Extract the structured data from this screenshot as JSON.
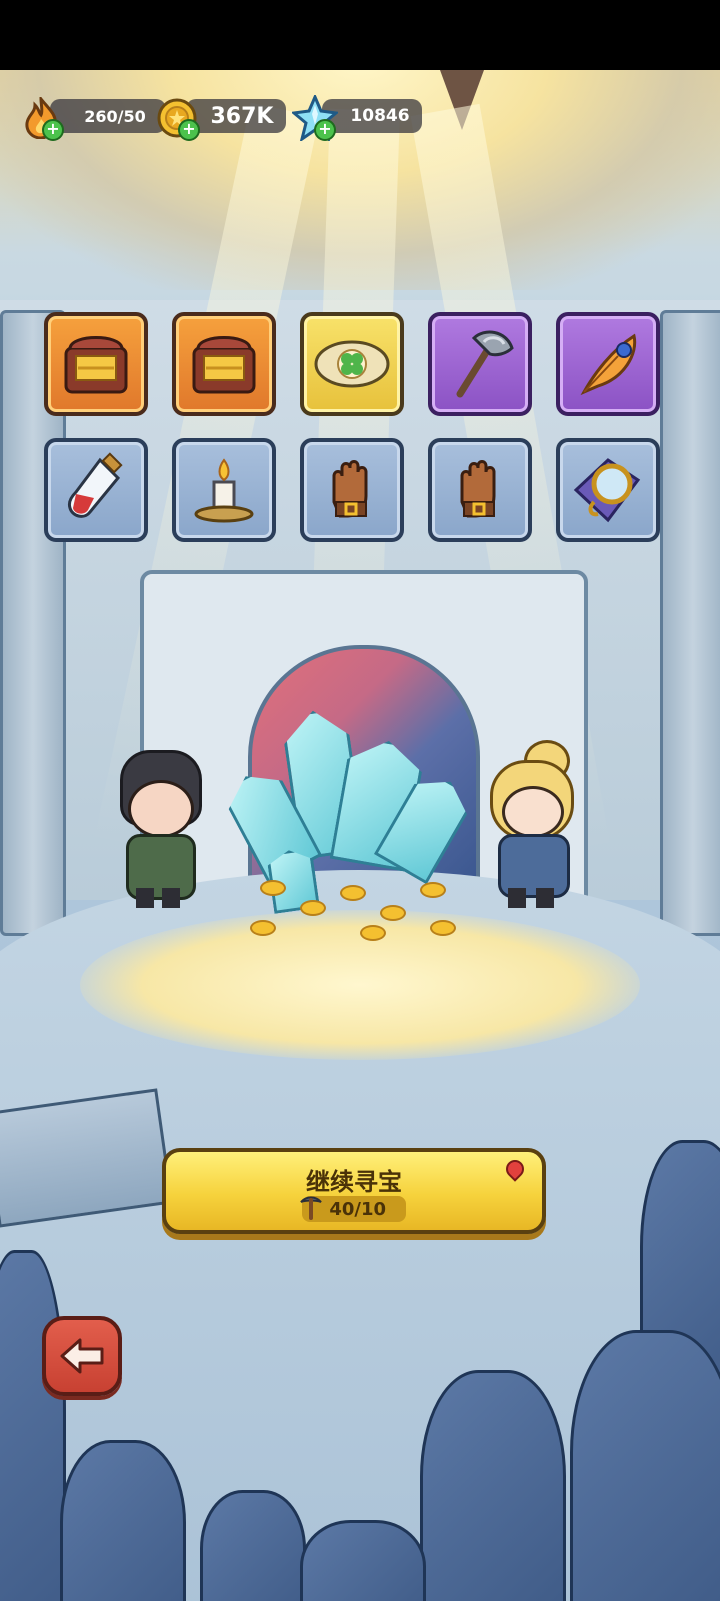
{
  "resources": {
    "energy": {
      "value": "260/50",
      "icon": "flame-icon"
    },
    "gold": {
      "value": "367K",
      "icon": "gold-coin-icon"
    },
    "gems": {
      "value": "10846",
      "icon": "blue-crystal-icon"
    }
  },
  "reward_items": [
    {
      "name": "gold-treasure-chest",
      "rarity": "orange",
      "icon": "treasure-chest-icon"
    },
    {
      "name": "gold-treasure-chest",
      "rarity": "orange",
      "icon": "treasure-chest-icon"
    },
    {
      "name": "clover-charm",
      "rarity": "yellow",
      "icon": "clover-charm-icon"
    },
    {
      "name": "battle-axe",
      "rarity": "purple",
      "icon": "axe-icon"
    },
    {
      "name": "phoenix-feather",
      "rarity": "purple",
      "icon": "feather-icon"
    },
    {
      "name": "red-potion",
      "rarity": "blue",
      "icon": "potion-icon"
    },
    {
      "name": "candle",
      "rarity": "blue",
      "icon": "candle-icon"
    },
    {
      "name": "leather-glove",
      "rarity": "blue",
      "icon": "glove-icon"
    },
    {
      "name": "leather-glove",
      "rarity": "blue",
      "icon": "glove-icon"
    },
    {
      "name": "pocket-mirror",
      "rarity": "blue",
      "icon": "mirror-icon"
    }
  ],
  "continue_button": {
    "label": "继续寻宝",
    "counter": "40/10",
    "icon": "pickaxe-icon"
  },
  "back_button": {
    "icon": "back-arrow-icon"
  },
  "colors": {
    "orange": "#f08f35",
    "yellow": "#f2d54d",
    "purple": "#9d66d3",
    "blue": "#9ab3d4",
    "cta": "#f6d23c",
    "back": "#d24f3e"
  }
}
